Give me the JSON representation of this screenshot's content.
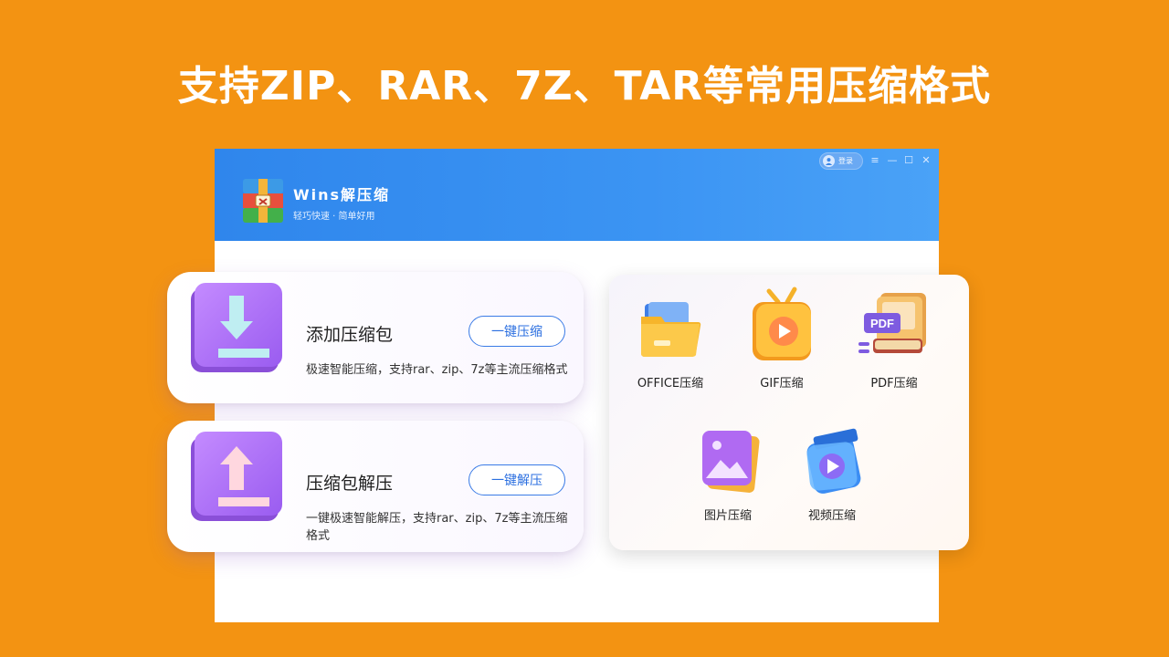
{
  "headline": "支持ZIP、RAR、7Z、TAR等常用压缩格式",
  "app": {
    "name": "Wins解压缩",
    "tagline": "轻巧快速 · 简单好用",
    "login_label": "登录",
    "controls": {
      "menu": "≡",
      "minimize": "—",
      "maximize": "☐",
      "close": "✕"
    }
  },
  "cards": [
    {
      "title": "添加压缩包",
      "button": "一键压缩",
      "description": "极速智能压缩，支持rar、zip、7z等主流压缩格式"
    },
    {
      "title": "压缩包解压",
      "button": "一键解压",
      "description": "一键极速智能解压，支持rar、zip、7z等主流压缩格式"
    }
  ],
  "tools": [
    {
      "label": "OFFICE压缩",
      "icon": "folder-icon"
    },
    {
      "label": "GIF压缩",
      "icon": "tv-play-icon"
    },
    {
      "label": "PDF压缩",
      "icon": "pdf-book-icon"
    },
    {
      "label": "图片压缩",
      "icon": "image-icon"
    },
    {
      "label": "视频压缩",
      "icon": "video-clapper-icon"
    }
  ],
  "pdf_badge": "PDF",
  "colors": {
    "background": "#f39312",
    "header_blue": "#3b94f3",
    "accent_purple": "#a66cf2",
    "button_blue": "#2b6fe0"
  }
}
